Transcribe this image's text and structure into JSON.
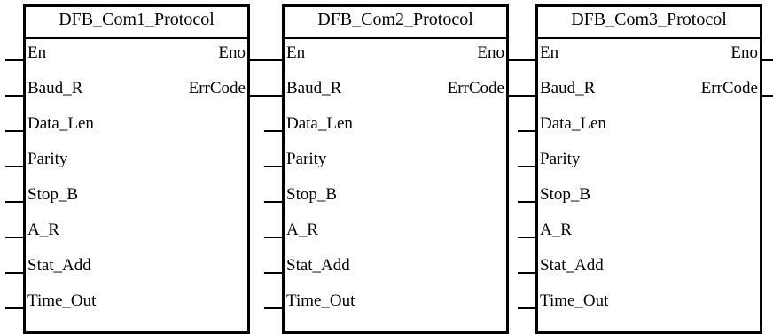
{
  "blocks": [
    {
      "title": "DFB_Com1_Protocol",
      "inputs": [
        "En",
        "Baud_R",
        "Data_Len",
        "Parity",
        "Stop_B",
        "A_R",
        "Stat_Add",
        "Time_Out"
      ],
      "outputs": [
        "Eno",
        "ErrCode"
      ]
    },
    {
      "title": "DFB_Com2_Protocol",
      "inputs": [
        "En",
        "Baud_R",
        "Data_Len",
        "Parity",
        "Stop_B",
        "A_R",
        "Stat_Add",
        "Time_Out"
      ],
      "outputs": [
        "Eno",
        "ErrCode"
      ]
    },
    {
      "title": "DFB_Com3_Protocol",
      "inputs": [
        "En",
        "Baud_R",
        "Data_Len",
        "Parity",
        "Stop_B",
        "A_R",
        "Stat_Add",
        "Time_Out"
      ],
      "outputs": [
        "Eno",
        "ErrCode"
      ]
    }
  ],
  "colors": {
    "line": "#000000",
    "background": "#ffffff"
  }
}
